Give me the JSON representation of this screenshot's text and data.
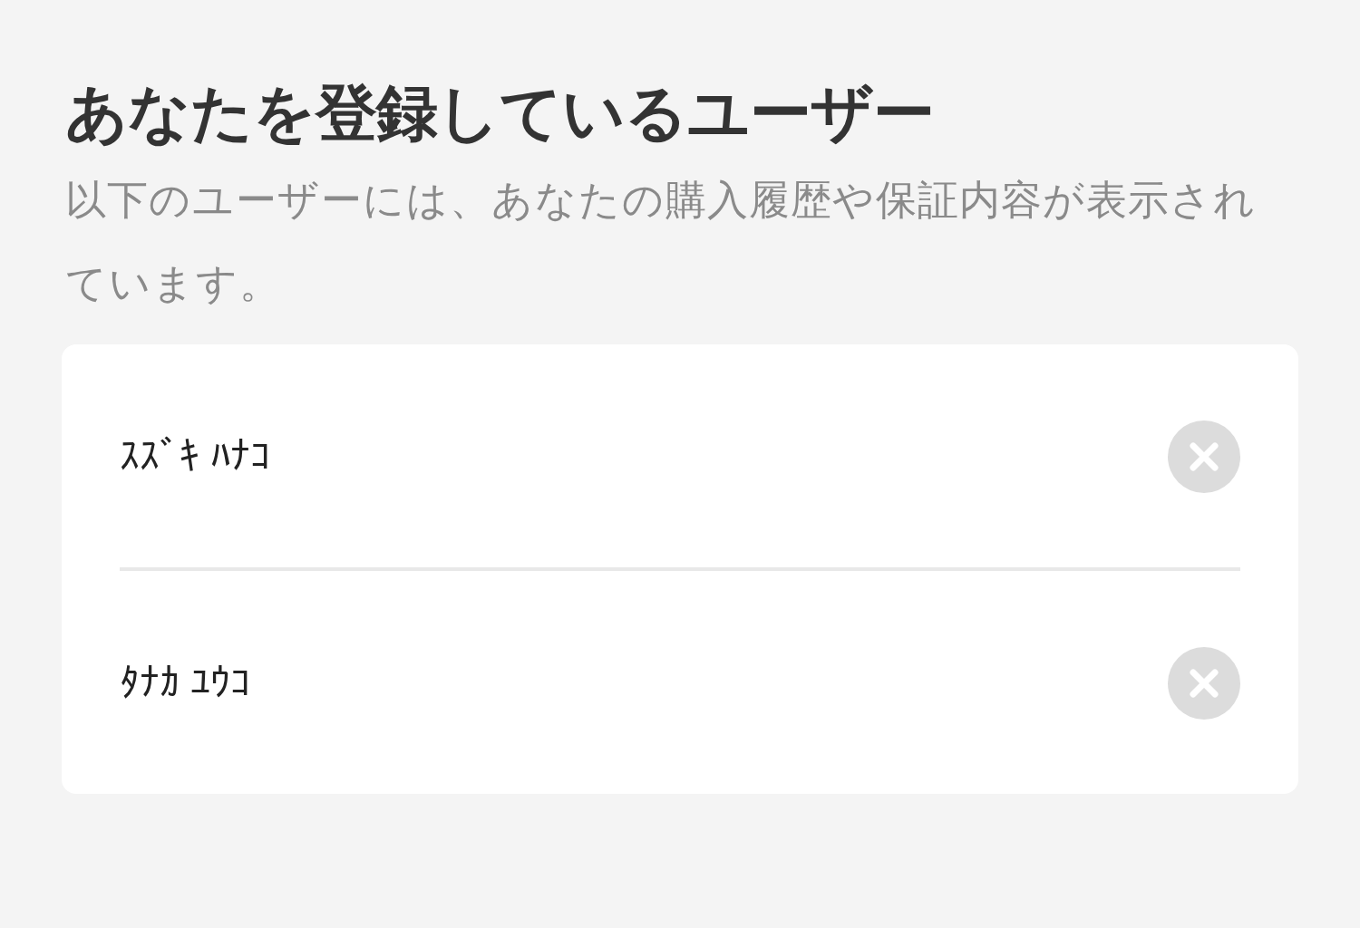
{
  "title": "あなたを登録しているユーザー",
  "description": "以下のユーザーには、あなたの購入履歴や保証内容が表示されています。",
  "users": [
    {
      "name": "ｽｽﾞｷ ﾊﾅｺ"
    },
    {
      "name": "ﾀﾅｶ ﾕｳｺ"
    }
  ]
}
